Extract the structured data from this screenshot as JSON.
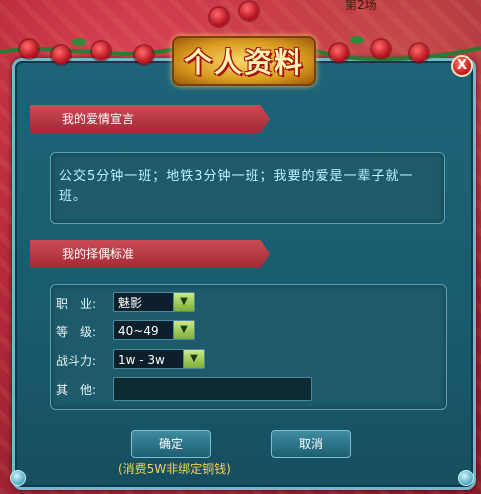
{
  "top_strip": {
    "text": "第2场"
  },
  "window": {
    "title": "个人资料"
  },
  "close_button": {
    "label": "X"
  },
  "love_declaration": {
    "header": "我的爱情宣言",
    "text": "公交5分钟一班；地铁3分钟一班；我要的爱是一辈子就一班。"
  },
  "mate_criteria": {
    "header": "我的择偶标准",
    "rows": [
      {
        "label": "职　业:",
        "value": "魅影"
      },
      {
        "label": "等　级:",
        "value": "40~49"
      },
      {
        "label": "战斗力:",
        "value": "1w - 3w"
      },
      {
        "label": "其　他:",
        "value": ""
      }
    ]
  },
  "buttons": {
    "confirm": "确定",
    "cancel": "取消"
  },
  "cost_note": "(消费5W非绑定铜钱)",
  "icons": {
    "dropdown": "chevron-down-icon",
    "close": "close-icon"
  }
}
